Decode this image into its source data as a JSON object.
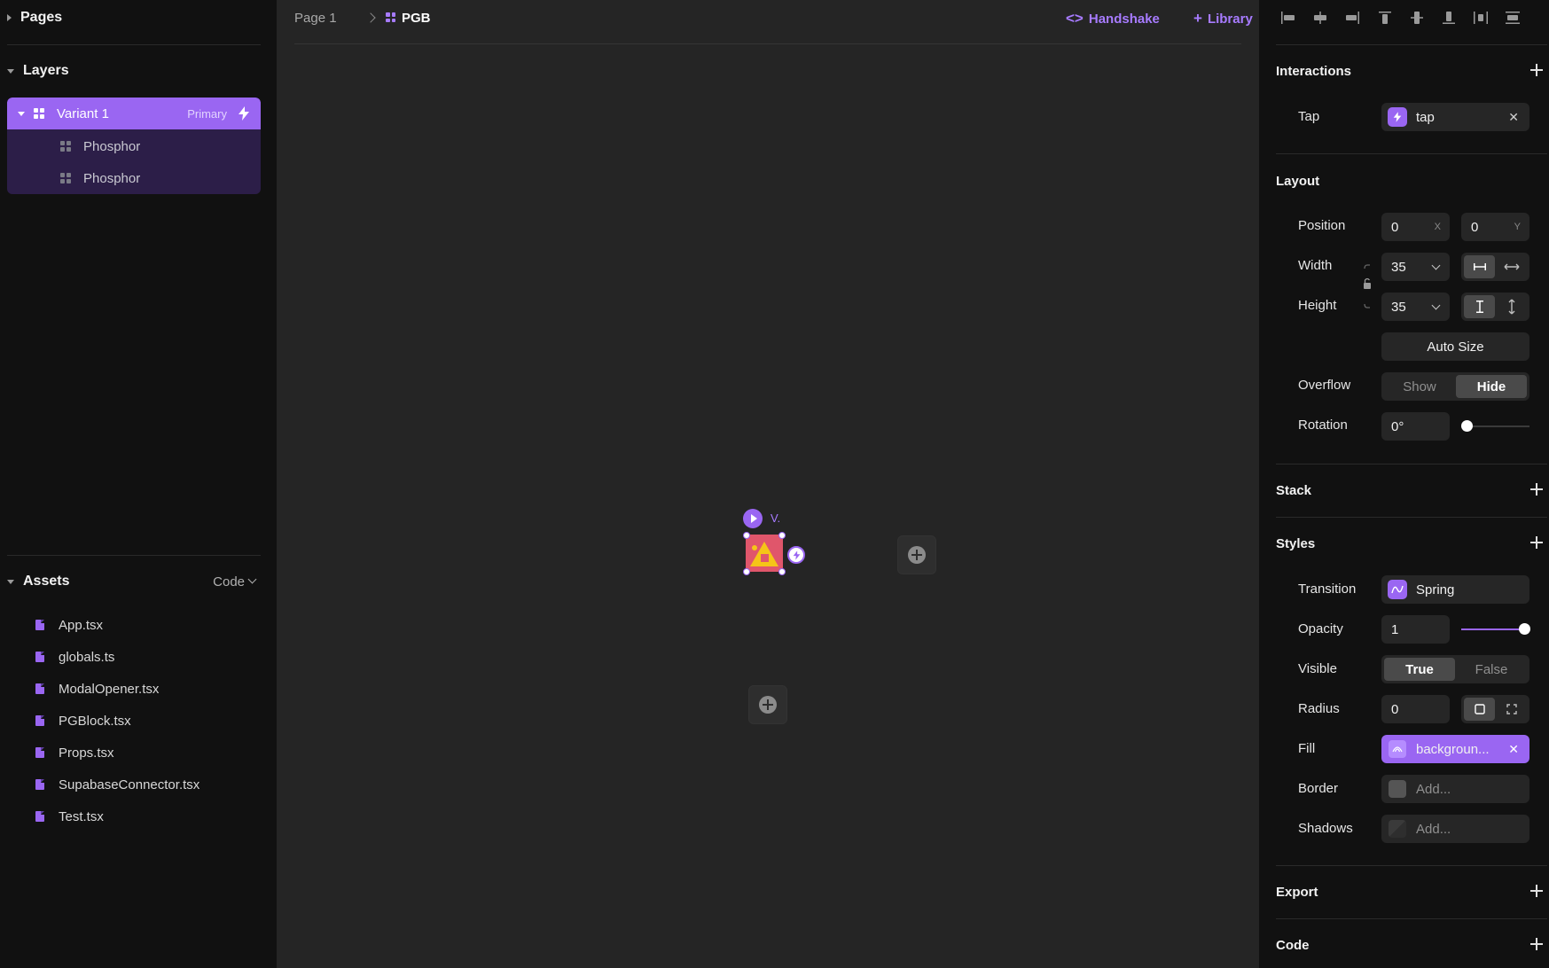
{
  "left": {
    "pages_title": "Pages",
    "layers_title": "Layers",
    "layers": [
      {
        "label": "Variant 1",
        "tag": "Primary"
      },
      {
        "label": "Phosphor"
      },
      {
        "label": "Phosphor"
      }
    ],
    "assets_title": "Assets",
    "assets_filter": "Code",
    "assets": [
      "App.tsx",
      "globals.ts",
      "ModalOpener.tsx",
      "PGBlock.tsx",
      "Props.tsx",
      "SupabaseConnector.tsx",
      "Test.tsx"
    ]
  },
  "canvas": {
    "breadcrumb": [
      "Page 1",
      "PGB"
    ],
    "handshake_label": "Handshake",
    "library_label": "Library",
    "node_label": "V."
  },
  "right": {
    "interactions": {
      "title": "Interactions",
      "tap_label": "Tap",
      "tap_value": "tap"
    },
    "layout": {
      "title": "Layout",
      "position_label": "Position",
      "x": "0",
      "x_axis": "X",
      "y": "0",
      "y_axis": "Y",
      "width_label": "Width",
      "width": "35",
      "height_label": "Height",
      "height": "35",
      "auto_size": "Auto Size",
      "overflow_label": "Overflow",
      "overflow_options": [
        "Show",
        "Hide"
      ],
      "overflow_selected": "Hide",
      "rotation_label": "Rotation",
      "rotation": "0°",
      "rotation_fraction": 0
    },
    "stack_title": "Stack",
    "styles": {
      "title": "Styles",
      "transition_label": "Transition",
      "transition": "Spring",
      "opacity_label": "Opacity",
      "opacity": "1",
      "opacity_fraction": 1,
      "visible_label": "Visible",
      "visible_options": [
        "True",
        "False"
      ],
      "visible_selected": "True",
      "radius_label": "Radius",
      "radius": "0",
      "fill_label": "Fill",
      "fill": "backgroun...",
      "border_label": "Border",
      "border_placeholder": "Add...",
      "shadows_label": "Shadows",
      "shadows_placeholder": "Add..."
    },
    "export_title": "Export",
    "code_title": "Code"
  },
  "colors": {
    "accent": "#9a66f2",
    "link": "#a77bff",
    "panel_bg": "#111111",
    "canvas_bg": "#252525"
  }
}
